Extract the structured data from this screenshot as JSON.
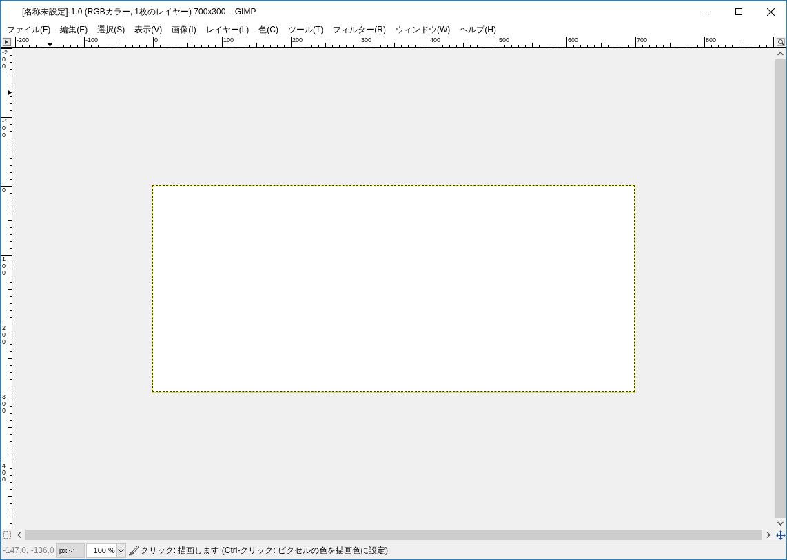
{
  "window": {
    "title": "[名称未設定]-1.0 (RGBカラー, 1枚のレイヤー) 700x300 – GIMP"
  },
  "menu": [
    {
      "label": "ファイル(F)"
    },
    {
      "label": "編集(E)"
    },
    {
      "label": "選択(S)"
    },
    {
      "label": "表示(V)"
    },
    {
      "label": "画像(I)"
    },
    {
      "label": "レイヤー(L)"
    },
    {
      "label": "色(C)"
    },
    {
      "label": "ツール(T)"
    },
    {
      "label": "フィルター(R)"
    },
    {
      "label": "ウィンドウ(W)"
    },
    {
      "label": "ヘルプ(H)"
    }
  ],
  "rulers": {
    "horizontal": [
      "-200",
      "-100",
      "0",
      "100",
      "200",
      "300",
      "400",
      "500",
      "600",
      "700",
      "800"
    ],
    "vertical": [
      "-200",
      "-100",
      "0",
      "100",
      "200",
      "300",
      "400"
    ]
  },
  "status_bar": {
    "coordinates": "-147.0, -136.0",
    "unit": "px",
    "zoom": "100 %",
    "message": "クリック: 描画します (Ctrl-クリック: ピクセルの色を描画色に設定)"
  }
}
